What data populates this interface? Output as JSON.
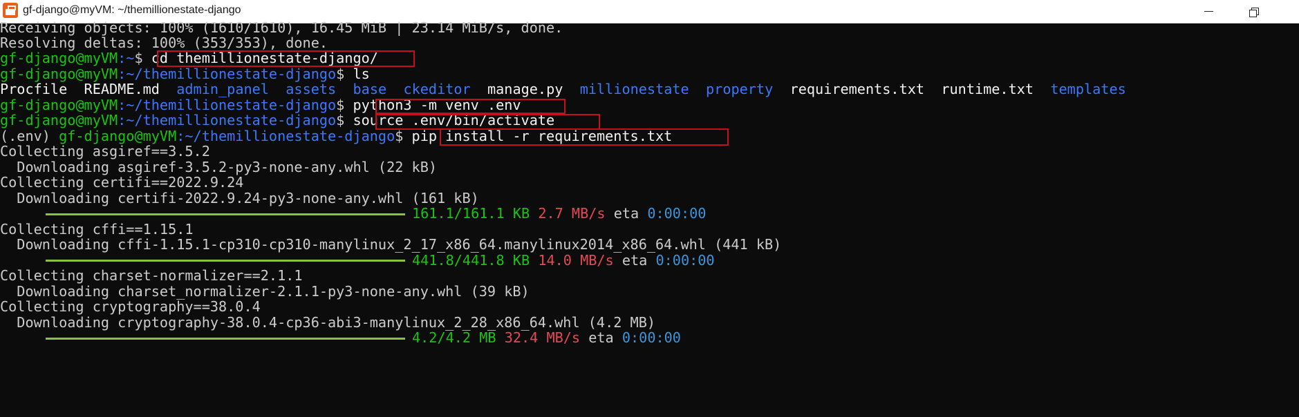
{
  "window": {
    "title": "gf-django@myVM: ~/themillionestate-django",
    "icon": "terminal-app-icon"
  },
  "prompt": {
    "user_host": "gf-django@myVM",
    "home": ":~",
    "repo_path": ":~/themillionestate-django",
    "dollar": "$",
    "venv": "(.env) "
  },
  "lines": {
    "l1": "Receiving objects: 100% (1610/1610), 16.45 MiB | 23.14 MiB/s, done.",
    "l2": "Resolving deltas: 100% (353/353), done.",
    "cmd_cd": " cd themillionestate-django/",
    "cmd_ls": " ls",
    "cmd_venv": " python3 -m venv .env",
    "cmd_source": " source .env/bin/activate",
    "cmd_pip": " pip install -r requirements.txt",
    "collect_asgiref": "Collecting asgiref==3.5.2",
    "dl_asgiref": "  Downloading asgiref-3.5.2-py3-none-any.whl (22 kB)",
    "collect_certifi": "Collecting certifi==2022.9.24",
    "dl_certifi": "  Downloading certifi-2022.9.24-py3-none-any.whl (161 kB)",
    "collect_cffi": "Collecting cffi==1.15.1",
    "dl_cffi": "  Downloading cffi-1.15.1-cp310-cp310-manylinux_2_17_x86_64.manylinux2014_x86_64.whl (441 kB)",
    "collect_charset": "Collecting charset-normalizer==2.1.1",
    "dl_charset": "  Downloading charset_normalizer-2.1.1-py3-none-any.whl (39 kB)",
    "collect_crypto": "Collecting cryptography==38.0.4",
    "dl_crypto": "  Downloading cryptography-38.0.4-cp36-abi3-manylinux_2_28_x86_64.whl (4.2 MB)"
  },
  "ls_output": {
    "f1": "Procfile",
    "f2": "README.md",
    "d1": "admin_panel",
    "d2": "assets",
    "d3": "base",
    "d4": "ckeditor",
    "f3": "manage.py",
    "d5": "millionestate",
    "d6": "property",
    "f4": "requirements.txt",
    "f5": "runtime.txt",
    "d7": "templates"
  },
  "progress": [
    {
      "size": "161.1/161.1 KB",
      "speed": "2.7 MB/s",
      "eta_label": "eta",
      "eta": "0:00:00",
      "fraction": 1.0
    },
    {
      "size": "441.8/441.8 KB",
      "speed": "14.0 MB/s",
      "eta_label": "eta",
      "eta": "0:00:00",
      "fraction": 1.0
    },
    {
      "size": "4.2/4.2 MB",
      "speed": "32.4 MB/s",
      "eta_label": "eta",
      "eta": "0:00:00",
      "fraction": 1.0
    }
  ],
  "colors": {
    "background": "#0c0c0c",
    "text": "#cccccc",
    "prompt_green": "#16c60c",
    "path_blue": "#3b78ff",
    "speed_red": "#e74856",
    "eta_cyan": "#3a96dd",
    "bar_green": "#8ac43f",
    "highlight_red": "#c50f1f"
  }
}
